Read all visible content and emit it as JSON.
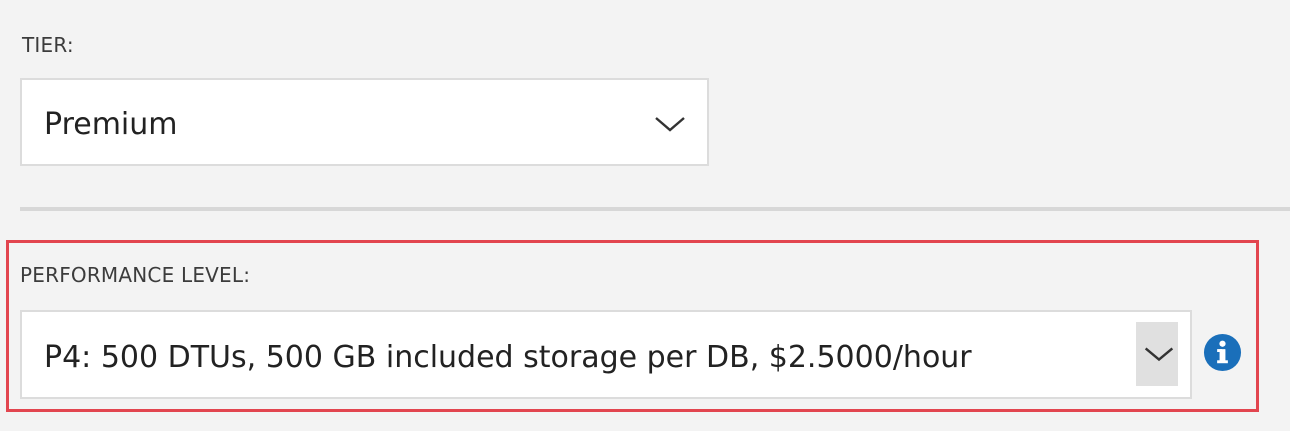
{
  "tier": {
    "label": "TIER:",
    "selected": "Premium",
    "icon": "chevron-down-icon"
  },
  "performance": {
    "label": "PERFORMANCE LEVEL:",
    "selected": "P4: 500 DTUs, 500 GB included storage per DB, $2.5000/hour",
    "icon": "chevron-down-icon",
    "info_icon": "info-icon"
  },
  "colors": {
    "background": "#f3f3f3",
    "highlight": "#e2454f",
    "info": "#1a6fba"
  }
}
